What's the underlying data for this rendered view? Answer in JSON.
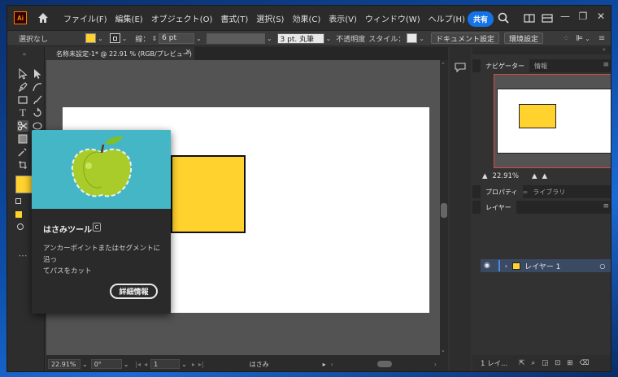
{
  "app": {
    "logo_text": "Ai",
    "menu": [
      "ファイル(F)",
      "編集(E)",
      "オブジェクト(O)",
      "書式(T)",
      "選択(S)",
      "効果(C)",
      "表示(V)",
      "ウィンドウ(W)",
      "ヘルプ(H)"
    ],
    "share_label": "共有",
    "window_controls": [
      "—",
      "❐",
      "✕"
    ]
  },
  "control_bar": {
    "selection_label": "選択なし",
    "fill_color": "#ffd22e",
    "stroke_label": "線：",
    "stroke_value": "6 pt",
    "brush_label": "3 pt. 丸筆",
    "opacity_label": "不透明度",
    "style_label": "スタイル：",
    "document_settings": "ドキュメント設定",
    "preferences": "環境設定"
  },
  "document": {
    "tab_title": "名称未設定-1* @ 22.91 % (RGB/プレビュー)",
    "tab_close": "×",
    "rect_fill": "#ffd22e"
  },
  "status": {
    "zoom": "22.91%",
    "angle": "0°",
    "artboard": "1",
    "tool": "はさみ"
  },
  "tooltip": {
    "title": "はさみツール",
    "shortcut": "C",
    "description_line1": "アンカーポイントまたはセグメントに沿っ",
    "description_line2": "てパスをカット",
    "more_info": "詳細情報"
  },
  "navigator": {
    "tabs": [
      "ナビゲーター",
      "情報"
    ],
    "zoom": "22.91%"
  },
  "properties": {
    "tabs": [
      "プロパティ",
      "ライブラリ"
    ]
  },
  "layers": {
    "tab": "レイヤー",
    "layer_name": "レイヤー 1",
    "layer_color": "#ffd22e",
    "footer_count": "1 レイ..."
  }
}
